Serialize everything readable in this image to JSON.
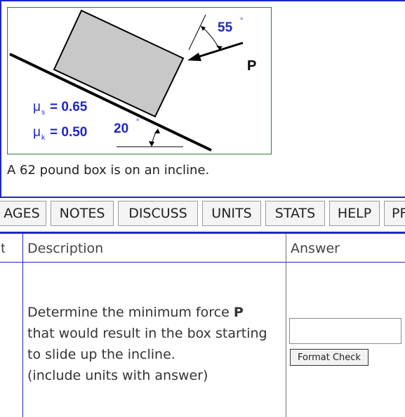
{
  "figure": {
    "angle_force": "55",
    "force_label": "P",
    "angle_incline": "20",
    "degree_symbol": "°",
    "mu_s": "μs = 0.65",
    "mu_k": "μk = 0.50",
    "mu_s_value": "= 0.65",
    "mu_k_value": "= 0.50",
    "mu_symbol": "μ",
    "mu_s_sub": "s",
    "mu_k_sub": "k"
  },
  "problem": {
    "statement": "A 62 pound box is on an incline."
  },
  "tabs": [
    {
      "label": "PAGES",
      "visible_text": "AGES"
    },
    {
      "label": "NOTES"
    },
    {
      "label": "DISCUSS"
    },
    {
      "label": "UNITS"
    },
    {
      "label": "STATS"
    },
    {
      "label": "HELP"
    },
    {
      "label": "PRINT",
      "visible_text": "PF"
    }
  ],
  "table": {
    "headers": {
      "part": "t",
      "description": "Description",
      "answer": "Answer"
    },
    "question": {
      "line1_prefix": "Determine the minimum force ",
      "line1_bold": "P",
      "line2": "that would result in the box starting",
      "line3": "to slide up the incline.",
      "line4": "(include units with answer)"
    },
    "answer_input": {
      "value": "",
      "placeholder": ""
    },
    "format_button_label": "Format Check"
  },
  "colors": {
    "frame_blue": "#1f26c8",
    "figure_border": "#2e7d32",
    "figure_label_blue": "#1f26c8",
    "box_fill": "#c8c8c8"
  }
}
